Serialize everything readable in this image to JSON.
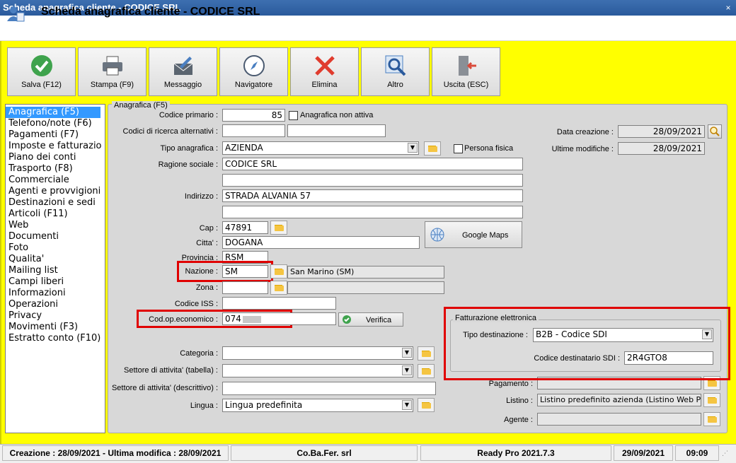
{
  "window": {
    "title": "Scheda anagrafica cliente - CODICE SRL",
    "close_label": "×"
  },
  "header": {
    "title": "Scheda anagrafica cliente - CODICE SRL"
  },
  "toolbar": [
    {
      "label": "Salva (F12)",
      "icon": "check-icon"
    },
    {
      "label": "Stampa (F9)",
      "icon": "printer-icon"
    },
    {
      "label": "Messaggio",
      "icon": "message-icon"
    },
    {
      "label": "Navigatore",
      "icon": "compass-icon"
    },
    {
      "label": "Elimina",
      "icon": "delete-x-icon"
    },
    {
      "label": "Altro",
      "icon": "magnifier-icon"
    },
    {
      "label": "Uscita (ESC)",
      "icon": "exit-door-icon"
    }
  ],
  "nav": [
    "Anagrafica (F5)",
    "Telefono/note (F6)",
    "Pagamenti (F7)",
    "Imposte e fatturazio",
    "Piano dei conti",
    "Trasporto (F8)",
    "Commerciale",
    "Agenti e provvigioni",
    "Destinazioni e sedi",
    "Articoli (F11)",
    "Web",
    "Documenti",
    "Foto",
    "Qualita'",
    "Mailing list",
    "Campi liberi",
    "Informazioni",
    "Operazioni",
    "Privacy",
    "Movimenti (F3)",
    "Estratto conto (F10)"
  ],
  "panel": {
    "legend": "Anagrafica (F5)"
  },
  "form": {
    "codice_primario_label": "Codice primario :",
    "codice_primario": "85",
    "non_attiva_label": "Anagrafica non attiva",
    "codici_ricerca_label": "Codici di ricerca alternativi :",
    "tipo_label": "Tipo anagrafica :",
    "tipo": "AZIENDA",
    "persona_fisica_label": "Persona fisica",
    "ragione_label": "Ragione sociale :",
    "ragione": "CODICE SRL",
    "indirizzo_label": "Indirizzo :",
    "indirizzo": "STRADA ALVANIA 57",
    "cap_label": "Cap :",
    "cap": "47891",
    "google_maps_label": "Google Maps",
    "citta_label": "Citta' :",
    "citta": "DOGANA",
    "provincia_label": "Provincia :",
    "provincia": "RSM",
    "nazione_label": "Nazione :",
    "nazione": "SM",
    "nazione_desc": "San Marino (SM)",
    "zona_label": "Zona :",
    "codice_iss_label": "Codice ISS :",
    "codop_label": "Cod.op.economico :",
    "codop": "074",
    "verifica_label": "Verifica",
    "categoria_label": "Categoria :",
    "settore_tab_label": "Settore di attivita' (tabella) :",
    "settore_desc_label": "Settore di attivita' (descrittivo) :",
    "lingua_label": "Lingua :",
    "lingua": "Lingua predefinita",
    "data_creazione_label": "Data creazione :",
    "data_creazione": "28/09/2021",
    "ultime_modifiche_label": "Ultime modifiche :",
    "ultime_modifiche": "28/09/2021",
    "pagamento_label": "Pagamento :",
    "listino_label": "Listino :",
    "listino": "Listino predefinito azienda (Listino Web PP)",
    "agente_label": "Agente :"
  },
  "fatturazione": {
    "legend": "Fatturazione elettronica",
    "tipo_label": "Tipo destinazione :",
    "tipo": "B2B - Codice SDI",
    "codice_label": "Codice destinatario SDI :",
    "codice": "2R4GTO8"
  },
  "status": {
    "creazione": "Creazione : 28/09/2021 - Ultima modifica : 28/09/2021",
    "azienda": "Co.Ba.Fer. srl",
    "versione": "Ready Pro 2021.7.3",
    "data": "29/09/2021",
    "ora": "09:09"
  },
  "colors": {
    "highlight_box": "#e00000",
    "background": "#ffff00",
    "selection": "#3399ff"
  }
}
